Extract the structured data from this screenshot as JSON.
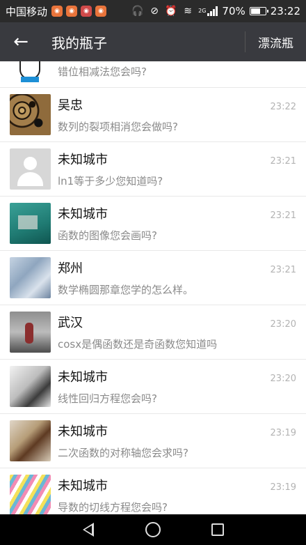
{
  "status_bar": {
    "carrier": "中国移动",
    "battery_percent": "70%",
    "battery_level": 0.7,
    "network": "2G",
    "time": "23:22",
    "icons": [
      "headset-icon",
      "mute-icon",
      "alarm-icon",
      "wifi-icon",
      "signal-icon",
      "battery-icon"
    ]
  },
  "header": {
    "title": "我的瓶子",
    "right_label": "漂流瓶",
    "back_icon": "arrow-left-icon"
  },
  "conversations": [
    {
      "name": "",
      "time": "",
      "preview": "错位相减法您会吗?",
      "avatar": "cartoon"
    },
    {
      "name": "吴忠",
      "time": "23:22",
      "preview": "数列的裂项相消您会做吗?",
      "avatar": "leopard"
    },
    {
      "name": "未知城市",
      "time": "23:21",
      "preview": "ln1等于多少您知道吗?",
      "avatar": "default"
    },
    {
      "name": "未知城市",
      "time": "23:21",
      "preview": "函数的图像您会画吗?",
      "avatar": "teal"
    },
    {
      "name": "郑州",
      "time": "23:21",
      "preview": "数学椭圆那章您学的怎么样。",
      "avatar": "snow"
    },
    {
      "name": "武汉",
      "time": "23:20",
      "preview": "cosx是偶函数还是奇函数您知道吗",
      "avatar": "street"
    },
    {
      "name": "未知城市",
      "time": "23:20",
      "preview": "线性回归方程您会吗?",
      "avatar": "camera"
    },
    {
      "name": "未知城市",
      "time": "23:19",
      "preview": "二次函数的对称轴您会求吗?",
      "avatar": "bracelet"
    },
    {
      "name": "未知城市",
      "time": "23:19",
      "preview": "导数的切线方程您会吗?",
      "avatar": "lines"
    }
  ],
  "navbar": {
    "icons": [
      "back-triangle-icon",
      "home-circle-icon",
      "recents-square-icon"
    ]
  }
}
